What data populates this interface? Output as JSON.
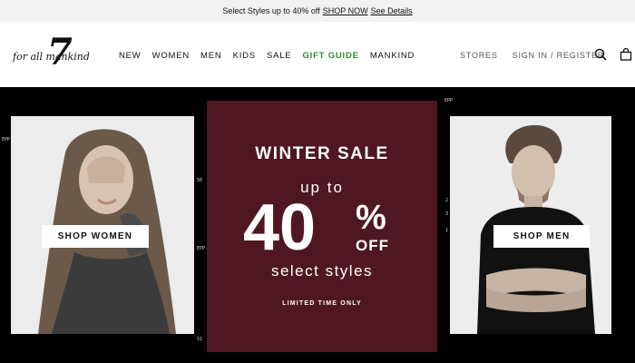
{
  "promo": {
    "text": "Select Styles up to 40% off",
    "shop_now": "SHOP NOW",
    "see_details": "See Details"
  },
  "header": {
    "logo": {
      "seven": "7",
      "script": "for all mankind"
    },
    "nav": [
      "NEW",
      "WOMEN",
      "MEN",
      "KIDS",
      "SALE",
      "GIFT GUIDE",
      "MANKIND"
    ],
    "stores": "STORES",
    "signin": "SIGN IN / REGISTER",
    "icons": [
      "search-icon",
      "shopping-bag-icon"
    ],
    "accent_color": "#2e8b2e"
  },
  "hero": {
    "shop_women": "SHOP WOMEN",
    "shop_men": "SHOP MEN",
    "sale": {
      "title": "WINTER SALE",
      "upto": "up to",
      "percent": "40",
      "percent_sign": "%",
      "off": "OFF",
      "select": "select styles",
      "limited": "LIMITED TIME ONLY",
      "panel_color": "#4e1722"
    },
    "film_marks": [
      "EPP",
      "50",
      "EPP 6G5",
      "51",
      "EPP",
      "2",
      "3",
      "1"
    ]
  }
}
